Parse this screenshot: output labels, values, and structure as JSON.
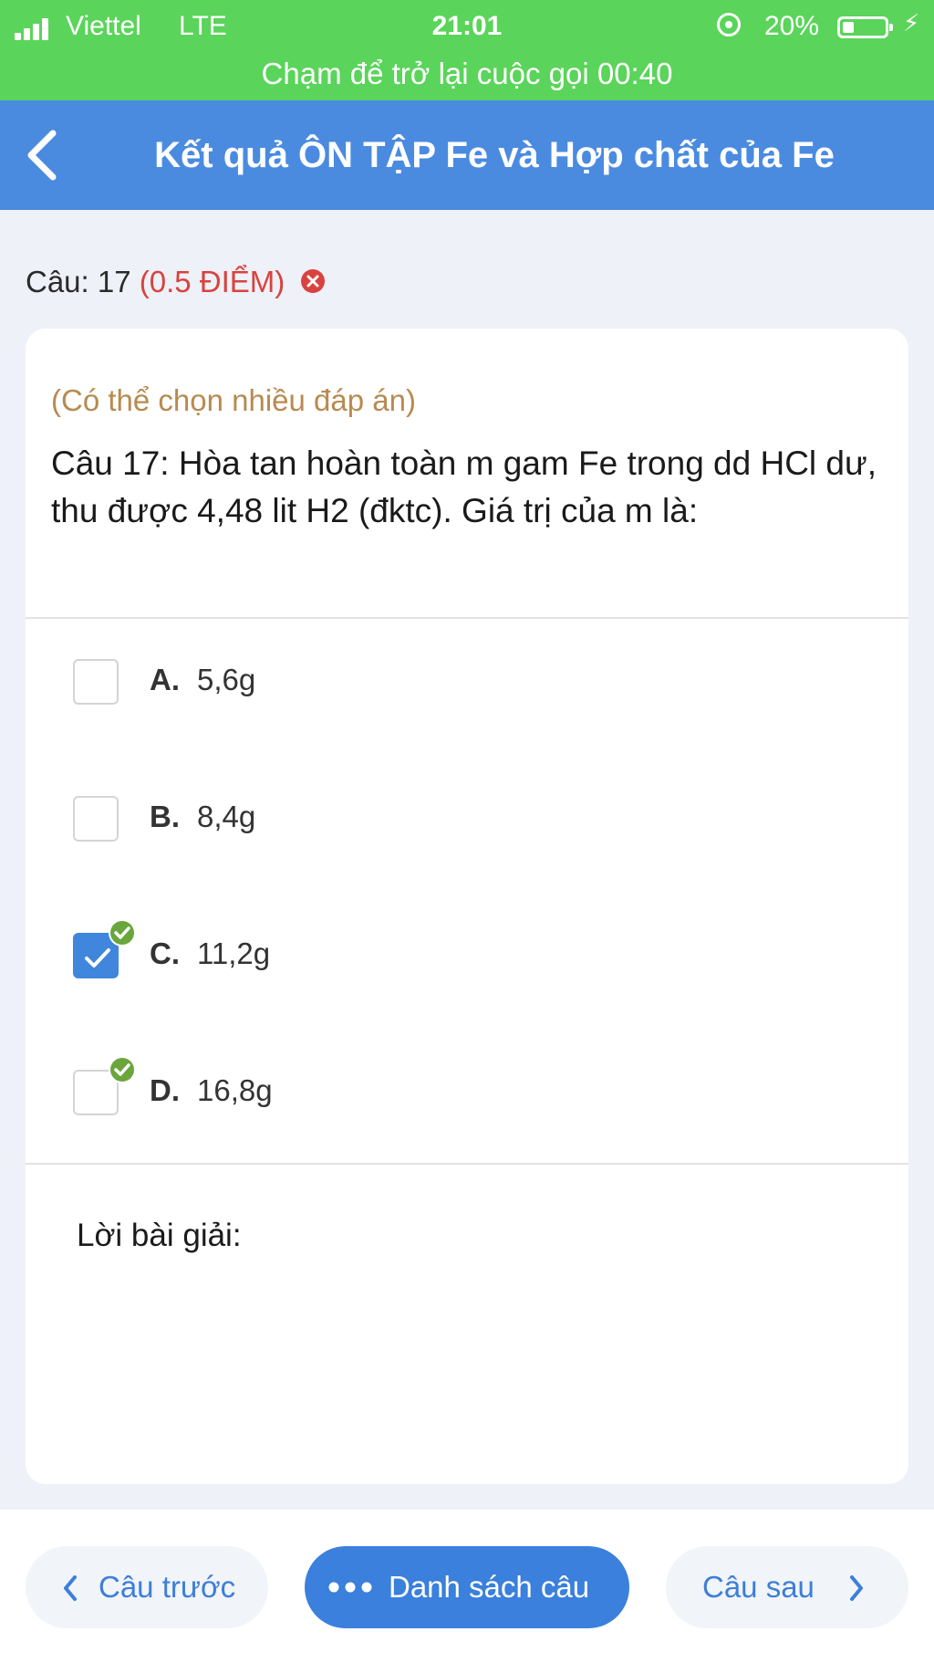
{
  "status_bar": {
    "carrier": "Viettel",
    "network": "LTE",
    "time": "21:01",
    "battery": "20%",
    "call_banner": "Chạm để trở lại cuộc gọi 00:40"
  },
  "header": {
    "title": "Kết quả ÔN TẬP Fe và Hợp chất của Fe",
    "back_icon": "chevron-left-icon"
  },
  "question": {
    "label": "Câu: 17",
    "points": "(0.5 ĐIỂM)",
    "result_icon": "wrong-x-circle-icon",
    "hint": "(Có thể chọn nhiều đáp án)",
    "text": "Câu 17: Hòa tan hoàn toàn m gam Fe trong dd HCl dư, thu được 4,48 lit H2 (đktc). Giá trị của m là:",
    "options": [
      {
        "letter": "A.",
        "value": "5,6g",
        "selected": false,
        "correct": false
      },
      {
        "letter": "B.",
        "value": "8,4g",
        "selected": false,
        "correct": false
      },
      {
        "letter": "C.",
        "value": "11,2g",
        "selected": true,
        "correct": true
      },
      {
        "letter": "D.",
        "value": "16,8g",
        "selected": false,
        "correct": true
      }
    ],
    "solution_label": "Lời bài giải:"
  },
  "footer": {
    "prev_label": "Câu trước",
    "list_label": "Danh sách câu",
    "next_label": "Câu sau"
  },
  "colors": {
    "status_bar": "#5ad45a",
    "header": "#4a8be0",
    "points": "#d8433f",
    "hint": "#b88a50",
    "correct_badge": "#6aa63c",
    "checkbox_selected": "#3f86dc"
  }
}
